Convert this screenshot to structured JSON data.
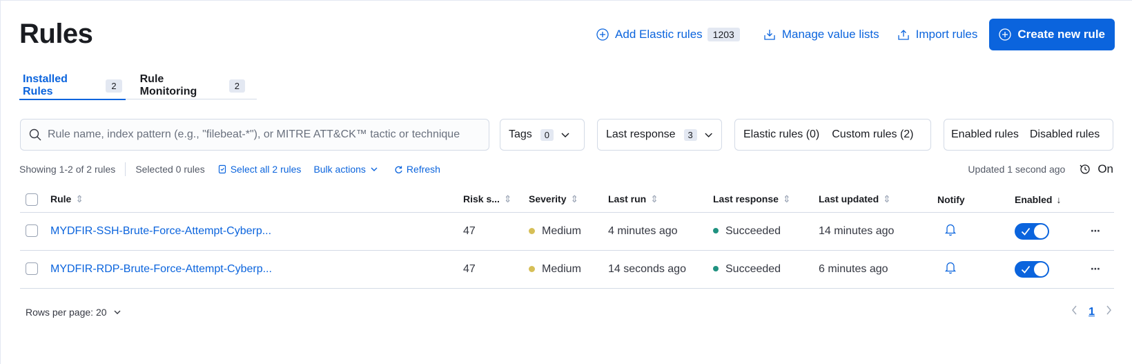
{
  "page": {
    "title": "Rules"
  },
  "header": {
    "add_elastic_label": "Add Elastic rules",
    "add_elastic_count": "1203",
    "manage_lists_label": "Manage value lists",
    "import_label": "Import rules",
    "create_label": "Create new rule"
  },
  "tabs": [
    {
      "label": "Installed Rules",
      "count": "2",
      "active": true
    },
    {
      "label": "Rule Monitoring",
      "count": "2",
      "active": false
    }
  ],
  "search": {
    "placeholder": "Rule name, index pattern (e.g., \"filebeat-*\"), or MITRE ATT&CK™ tactic or technique",
    "value": ""
  },
  "filters": {
    "tags_label": "Tags",
    "tags_count": "0",
    "last_response_label": "Last response",
    "last_response_count": "3",
    "elastic_rules_label": "Elastic rules (0)",
    "custom_rules_label": "Custom rules (2)",
    "enabled_label": "Enabled rules",
    "disabled_label": "Disabled rules"
  },
  "utility": {
    "showing": "Showing 1-2 of 2 rules",
    "selected": "Selected 0 rules",
    "select_all": "Select all 2 rules",
    "bulk_actions": "Bulk actions",
    "refresh": "Refresh",
    "updated": "Updated 1 second ago",
    "auto_refresh": "On"
  },
  "table": {
    "columns": {
      "rule": "Rule",
      "risk": "Risk s...",
      "severity": "Severity",
      "last_run": "Last run",
      "last_response": "Last response",
      "last_updated": "Last updated",
      "notify": "Notify",
      "enabled": "Enabled"
    },
    "rows": [
      {
        "name": "MYDFIR-SSH-Brute-Force-Attempt-Cyberp...",
        "risk": "47",
        "severity": "Medium",
        "last_run": "4 minutes ago",
        "last_response": "Succeeded",
        "last_updated": "14 minutes ago",
        "enabled": true
      },
      {
        "name": "MYDFIR-RDP-Brute-Force-Attempt-Cyberp...",
        "risk": "47",
        "severity": "Medium",
        "last_run": "14 seconds ago",
        "last_response": "Succeeded",
        "last_updated": "6 minutes ago",
        "enabled": true
      }
    ]
  },
  "footer": {
    "rows_per_page": "Rows per page: 20",
    "page": "1"
  },
  "colors": {
    "accent": "#0b64dd",
    "severity_medium": "#d6bf57",
    "success": "#209280"
  },
  "icons": {
    "add": "plus-in-circle-icon",
    "manage": "download-tray-icon",
    "import": "import-tray-icon",
    "search": "search-icon",
    "chevron": "chevron-down-icon",
    "sort": "sortable-icon",
    "bell": "bell-icon",
    "refresh": "refresh-icon",
    "more": "boxes-horizontal-icon"
  }
}
